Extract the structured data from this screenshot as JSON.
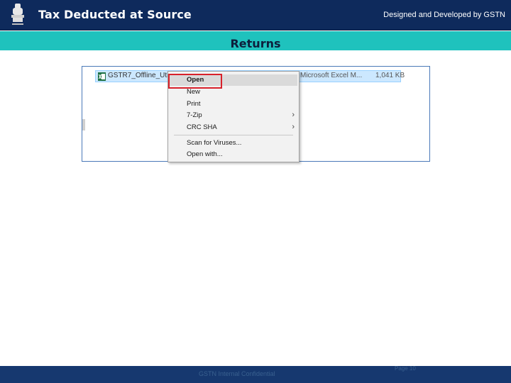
{
  "header": {
    "title": "Tax Deducted at Source",
    "credit": "Designed and Developed by GSTN",
    "emblem_icon": "national-emblem-icon",
    "background": "#0e2a5c"
  },
  "subheader": {
    "title": "Returns",
    "background": "#1fc2bd"
  },
  "explorer": {
    "file": {
      "icon": "excel-file-icon",
      "name": "GSTR7_Offline_Utility",
      "type": "Microsoft Excel M...",
      "size": "1,041 KB"
    },
    "context_menu": {
      "items": [
        {
          "label": "Open",
          "has_submenu": false,
          "highlighted": true
        },
        {
          "label": "New",
          "has_submenu": false,
          "highlighted": false
        },
        {
          "label": "Print",
          "has_submenu": false,
          "highlighted": false
        },
        {
          "label": "7-Zip",
          "has_submenu": true,
          "highlighted": false
        },
        {
          "label": "CRC SHA",
          "has_submenu": true,
          "highlighted": false
        },
        {
          "label": "Scan for Viruses...",
          "has_submenu": false,
          "highlighted": false
        },
        {
          "label": "Open with...",
          "has_submenu": false,
          "highlighted": false
        }
      ],
      "submenu_glyph": "›",
      "highlight_color": "#d8212b"
    }
  },
  "footer": {
    "text": "GSTN Internal Confidential",
    "page": "Page 10",
    "background": "#16386f"
  }
}
